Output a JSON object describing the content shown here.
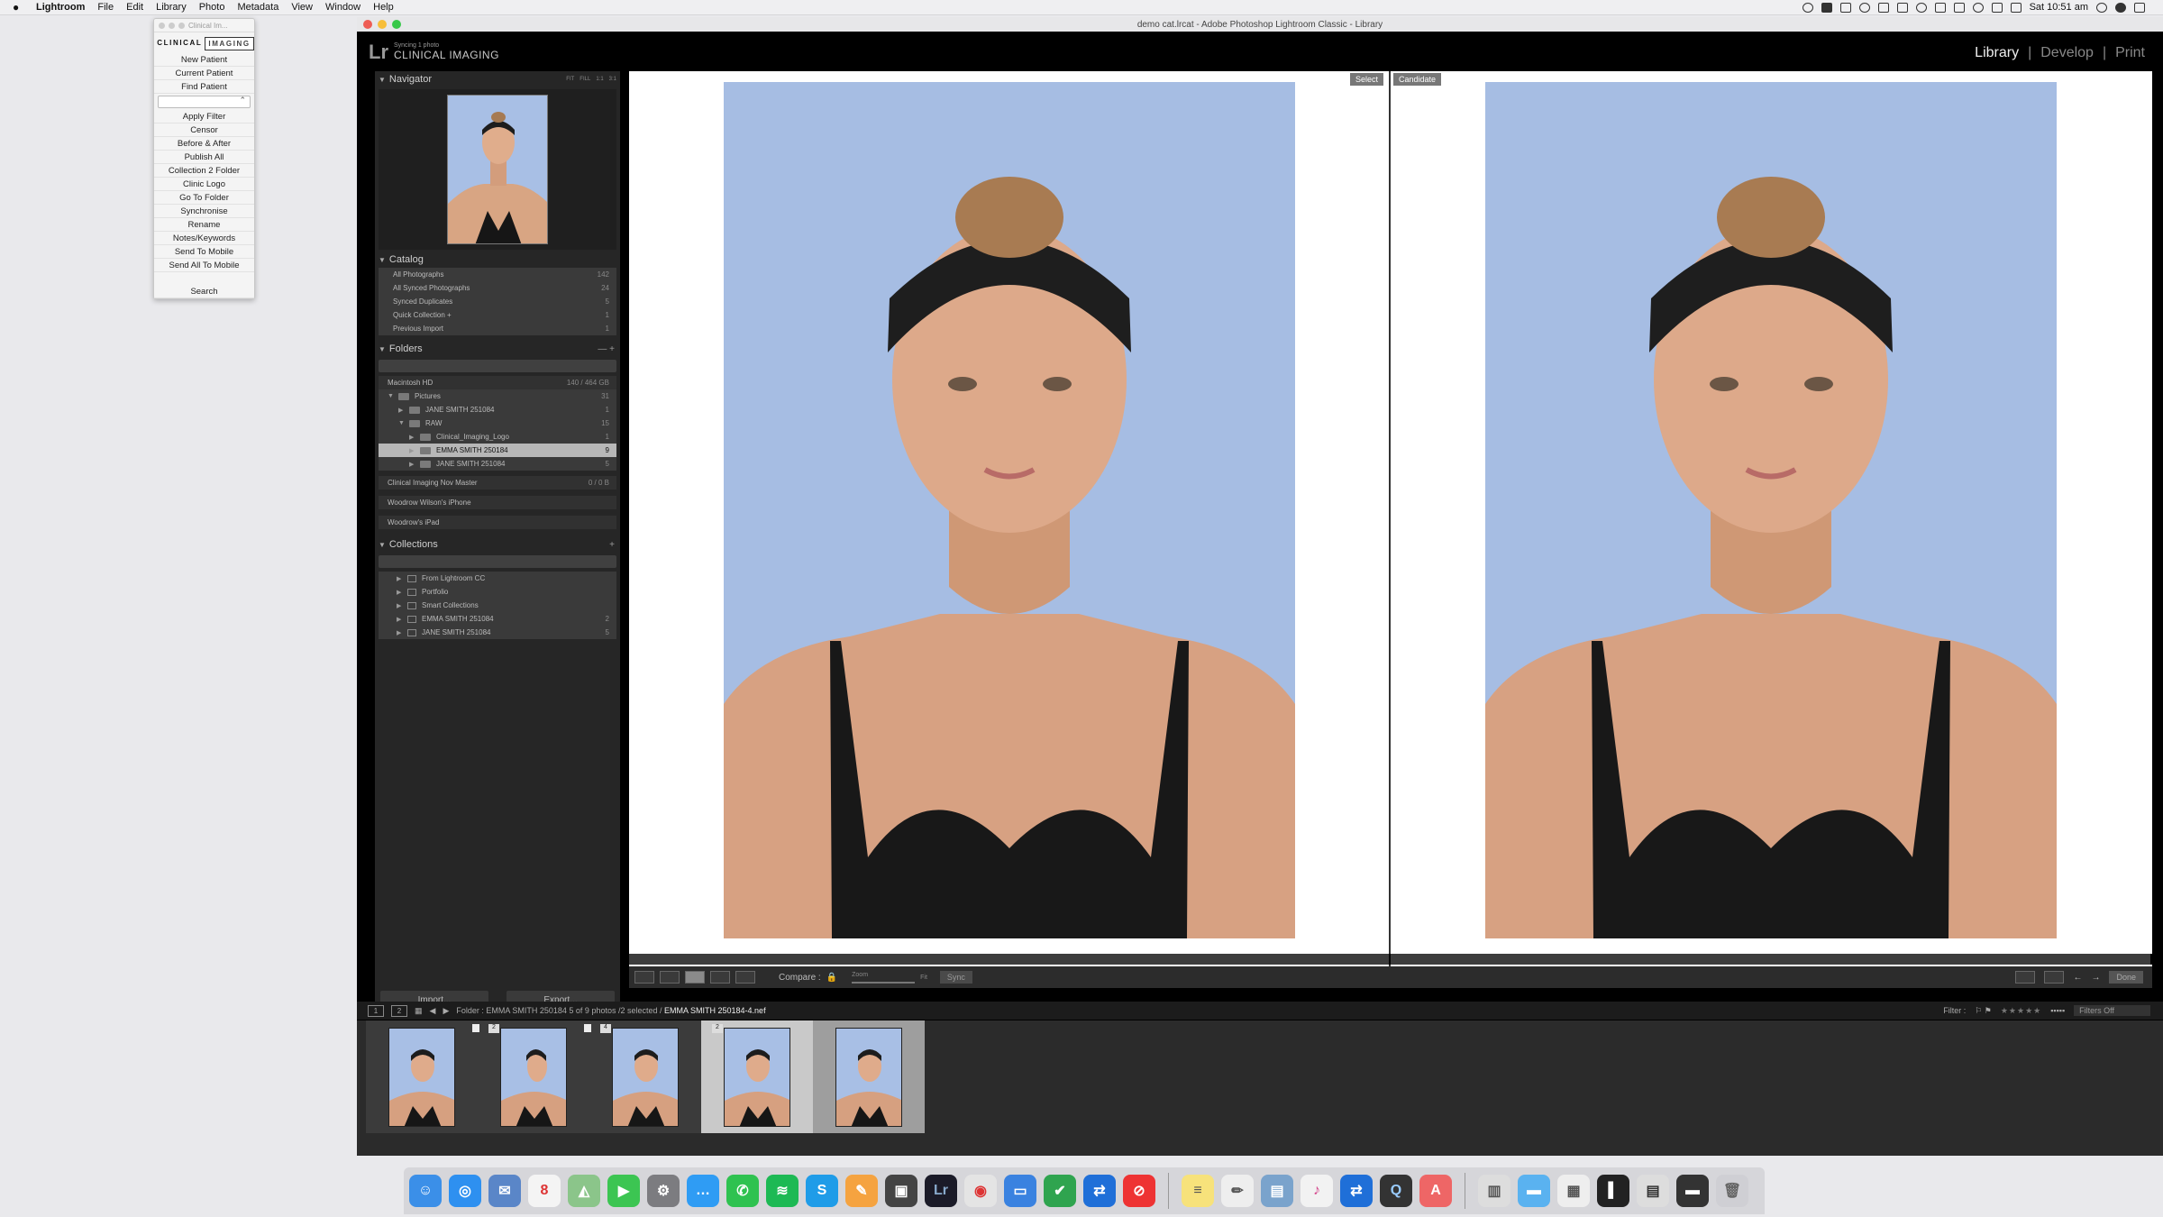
{
  "menubar": {
    "app": "Lightroom",
    "items": [
      "File",
      "Edit",
      "Library",
      "Photo",
      "Metadata",
      "View",
      "Window",
      "Help"
    ],
    "clock": "Sat 10:51 am"
  },
  "palette": {
    "title": "Clinical Im...",
    "logo_a": "CLINICAL",
    "logo_b": "IMAGING",
    "items_a": [
      "New Patient",
      "Current Patient",
      "Find Patient"
    ],
    "items_b": [
      "Apply Filter",
      "Censor",
      "Before & After",
      "Publish All",
      "Collection 2 Folder",
      "Clinic Logo",
      "Go To Folder",
      "Synchronise",
      "Rename",
      "Notes/Keywords",
      "Send To Mobile",
      "Send All To Mobile"
    ],
    "search": "Search"
  },
  "window": {
    "title": "demo cat.lrcat - Adobe Photoshop Lightroom Classic - Library",
    "identity_small": "Syncing 1 photo",
    "identity_large": "CLINICAL IMAGING",
    "logo": "Lr",
    "modules": [
      "Library",
      "Develop",
      "Print"
    ],
    "active_module": "Library"
  },
  "left_panel": {
    "navigator": {
      "title": "Navigator",
      "opts": [
        "FIT",
        "FILL",
        "1:1",
        "3:1"
      ]
    },
    "catalog": {
      "title": "Catalog",
      "rows": [
        {
          "label": "All Photographs",
          "count": "142"
        },
        {
          "label": "All Synced Photographs",
          "count": "24"
        },
        {
          "label": "Synced Duplicates",
          "count": "5"
        },
        {
          "label": "Quick Collection +",
          "count": "1"
        },
        {
          "label": "Previous Import",
          "count": "1"
        }
      ]
    },
    "folders": {
      "title": "Folders",
      "volume": {
        "label": "Macintosh HD",
        "count": "140 / 464 GB"
      },
      "rows": [
        {
          "label": "Pictures",
          "count": "31",
          "depth": 1,
          "caret": "▼"
        },
        {
          "label": "JANE SMITH 251084",
          "count": "1",
          "depth": 2,
          "caret": "▶"
        },
        {
          "label": "RAW",
          "count": "15",
          "depth": 2,
          "caret": "▼"
        },
        {
          "label": "Clinical_Imaging_Logo",
          "count": "1",
          "depth": 3,
          "caret": "▶"
        },
        {
          "label": "EMMA SMITH 250184",
          "count": "9",
          "depth": 3,
          "caret": "▶",
          "selected": true
        },
        {
          "label": "JANE SMITH 251084",
          "count": "5",
          "depth": 3,
          "caret": "▶"
        }
      ],
      "extra": [
        {
          "label": "Clinical Imaging Nov Master",
          "count": "0 / 0 B"
        },
        {
          "label": "Woodrow Wilson's iPhone",
          "count": ""
        },
        {
          "label": "Woodrow's iPad",
          "count": ""
        }
      ]
    },
    "collections": {
      "title": "Collections",
      "rows": [
        {
          "label": "From Lightroom CC",
          "count": ""
        },
        {
          "label": "Portfolio",
          "count": ""
        },
        {
          "label": "Smart Collections",
          "count": ""
        },
        {
          "label": "EMMA SMITH 251084",
          "count": "2"
        },
        {
          "label": "JANE SMITH 251084",
          "count": "5"
        }
      ]
    },
    "import_label": "Import...",
    "export_label": "Export..."
  },
  "compare": {
    "select_tag": "Select",
    "candidate_tag": "Candidate"
  },
  "toolbar": {
    "compare_label": "Compare :",
    "zoom_label": "Zoom",
    "fit_label": "Fit",
    "sync_label": "Sync",
    "done_label": "Done"
  },
  "filmstrip": {
    "page1": "1",
    "page2": "2",
    "folder": "Folder : EMMA SMITH 250184",
    "count": "5 of 9 photos /2 selected /",
    "file": "EMMA SMITH 250184-4.nef",
    "filter_label": "Filter :",
    "filters_off": "Filters Off",
    "thumbs": [
      {
        "num": "",
        "selected": false
      },
      {
        "num": "2",
        "selected": false
      },
      {
        "num": "4",
        "selected": false
      },
      {
        "num": "2",
        "selected": true
      },
      {
        "num": "",
        "selected": true
      }
    ]
  },
  "colors": {
    "accent": "#c9c9c9",
    "photo_bg": "#a8bfe5"
  },
  "dock": {
    "apps": [
      "finder",
      "safari",
      "mail",
      "calendar",
      "maps",
      "facetime",
      "system-preferences",
      "messages",
      "whatsapp",
      "spotify",
      "skype",
      "pages",
      "final-cut",
      "lightroom",
      "chrome",
      "keynote",
      "things",
      "teamviewer",
      "prohibit",
      "notes",
      "textedit",
      "preview",
      "itunes",
      "teamviewer2",
      "quicktime",
      "adobe",
      "app-store",
      "folder",
      "files",
      "terminal",
      "screens",
      "stack",
      "trash"
    ]
  }
}
